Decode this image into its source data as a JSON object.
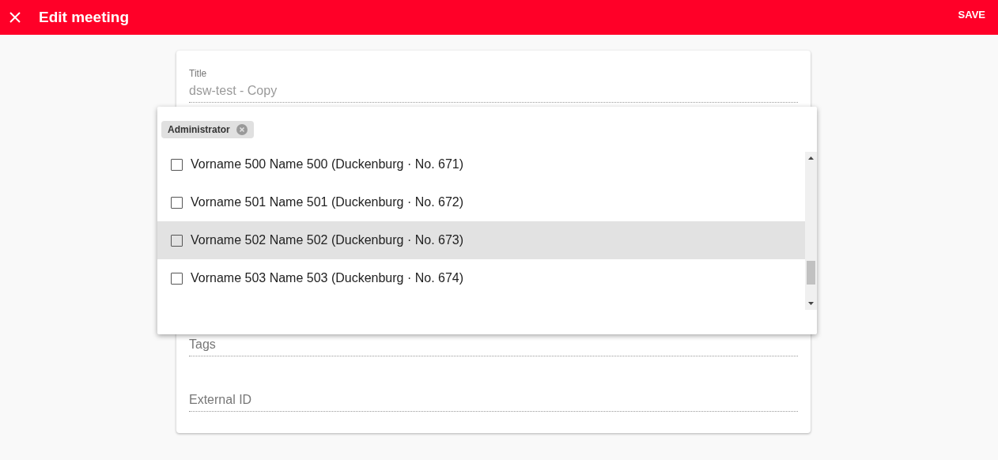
{
  "app_bar": {
    "title": "Edit meeting",
    "action": "SAVE"
  },
  "form": {
    "fields": [
      {
        "kind": "filled",
        "label": "Title",
        "value": "dsw-test - Copy"
      },
      {
        "kind": "empty",
        "placeholder": "Tags"
      },
      {
        "kind": "empty",
        "placeholder": "External ID"
      }
    ]
  },
  "dropdown": {
    "chips": [
      {
        "label": "Administrator"
      }
    ],
    "options": [
      {
        "label": "Vorname 500 Name 500 (Duckenburg · No. 671)",
        "checked": false,
        "highlighted": false
      },
      {
        "label": "Vorname 501 Name 501 (Duckenburg · No. 672)",
        "checked": false,
        "highlighted": false
      },
      {
        "label": "Vorname 502 Name 502 (Duckenburg · No. 673)",
        "checked": false,
        "highlighted": true
      },
      {
        "label": "Vorname 503 Name 503 (Duckenburg · No. 674)",
        "checked": false,
        "highlighted": false
      }
    ]
  }
}
